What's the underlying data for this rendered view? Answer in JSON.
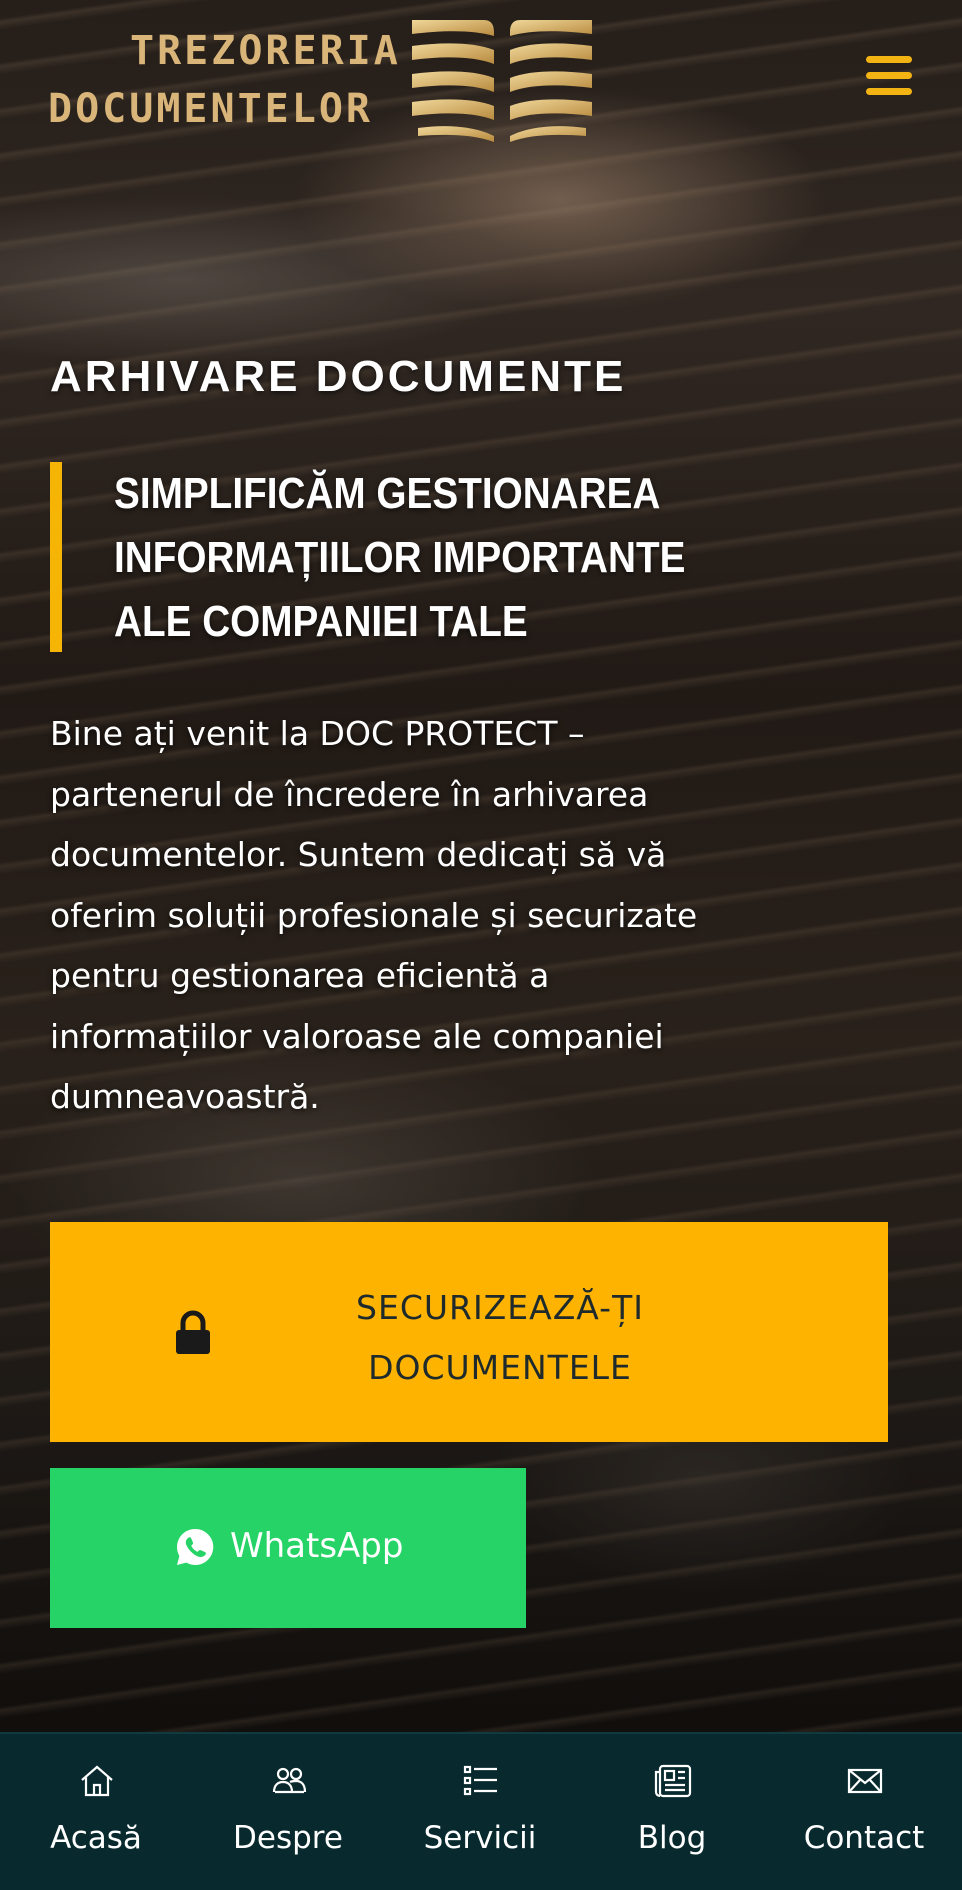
{
  "brand": {
    "line1": "TREZORERIA",
    "line2": "DOCUMENTELOR",
    "logo_icon": "book-pages-logo",
    "gold": "#d9b57a"
  },
  "header": {
    "menu_icon": "hamburger-menu-icon",
    "accent": "#f3b312"
  },
  "hero": {
    "heading": "ARHIVARE DOCUMENTE",
    "tagline": "SIMPLIFICĂM GESTIONAREA INFORMAȚIILOR IMPORTANTE ALE COMPANIEI TALE",
    "intro": "Bine ați venit la DOC PROTECT – partenerul de încredere în arhivarea documentelor. Suntem dedicați să vă oferim soluții profesionale și securizate pentru gestionarea eficientă a informațiilor valoroase ale companiei dumneavoastră."
  },
  "cta": {
    "label": "SECURIZEAZĂ-ȚI DOCUMENTELE",
    "icon": "lock-icon",
    "color": "#fdb300"
  },
  "whatsapp": {
    "label": "WhatsApp",
    "icon": "whatsapp-icon",
    "color": "#25d366"
  },
  "bottom_nav": {
    "background": "#082a2e",
    "items": [
      {
        "label": "Acasă",
        "icon": "home-icon"
      },
      {
        "label": "Despre",
        "icon": "users-icon"
      },
      {
        "label": "Servicii",
        "icon": "list-icon"
      },
      {
        "label": "Blog",
        "icon": "newspaper-icon"
      },
      {
        "label": "Contact",
        "icon": "envelope-icon"
      }
    ]
  }
}
